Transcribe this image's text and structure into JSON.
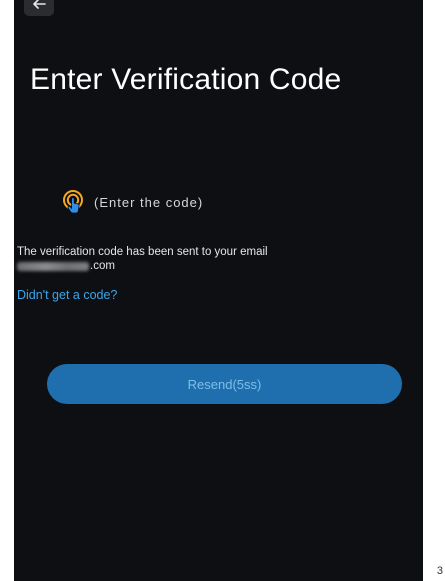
{
  "header": {
    "back_icon": "back-arrow-icon",
    "title": "Enter Verification Code"
  },
  "hint": {
    "icon": "touch-icon",
    "text": "(Enter the code)"
  },
  "message": {
    "sent_text": "The verification code has been sent to your email",
    "email_suffix": ".com"
  },
  "links": {
    "no_code": "Didn't get a code?"
  },
  "actions": {
    "resend_label": "Resend(5ss)"
  },
  "page_number": "3",
  "colors": {
    "background": "#0e0f12",
    "accent": "#3aa6ec",
    "button": "#1f6fae"
  }
}
